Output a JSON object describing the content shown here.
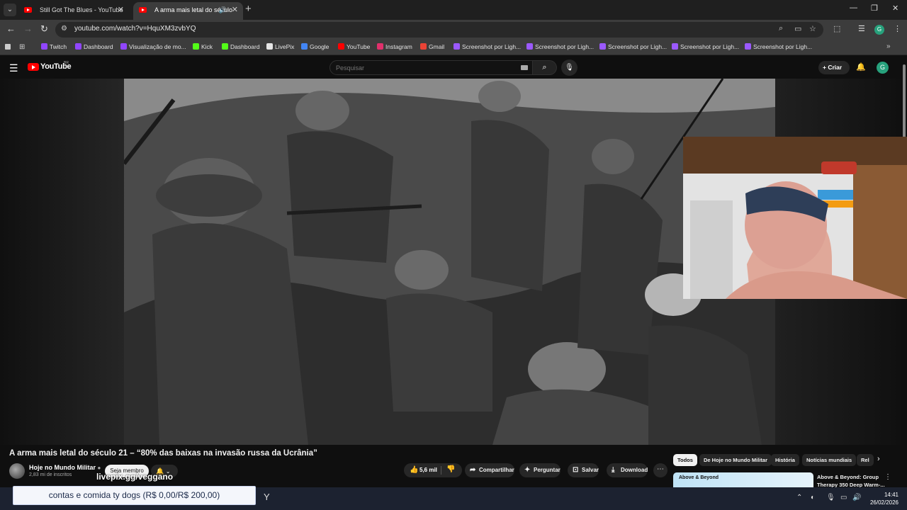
{
  "browser": {
    "tabs": [
      {
        "title": "Still Got The Blues - YouTube",
        "active": false
      },
      {
        "title": "A arma mais letal do século",
        "active": true
      }
    ],
    "url": "youtube.com/watch?v=HquXM3zvbYQ",
    "bookmarks": [
      {
        "label": "Twitch",
        "color": "#9146ff"
      },
      {
        "label": "Dashboard",
        "color": "#9146ff"
      },
      {
        "label": "Visualização de mo...",
        "color": "#9146ff"
      },
      {
        "label": "Kick",
        "color": "#53fc18"
      },
      {
        "label": "Dashboard",
        "color": "#53fc18"
      },
      {
        "label": "LivePix",
        "color": "#e6e6e6"
      },
      {
        "label": "Google",
        "color": "#4285f4"
      },
      {
        "label": "YouTube",
        "color": "#ff0000"
      },
      {
        "label": "Instagram",
        "color": "#e1306c"
      },
      {
        "label": "Gmail",
        "color": "#ea4335"
      },
      {
        "label": "Screenshot por Ligh...",
        "color": "#9b59ff"
      },
      {
        "label": "Screenshot por Ligh...",
        "color": "#9b59ff"
      },
      {
        "label": "Screenshot por Ligh...",
        "color": "#9b59ff"
      },
      {
        "label": "Screenshot por Ligh...",
        "color": "#9b59ff"
      },
      {
        "label": "Screenshot por Ligh...",
        "color": "#9b59ff"
      }
    ],
    "profile_initial": "G"
  },
  "youtube": {
    "logo_text": "YouTube",
    "region": "BR",
    "search_placeholder": "Pesquisar",
    "create_label": "Criar",
    "avatar_initial": "G"
  },
  "video": {
    "title": "A arma mais letal do século 21 – “80% das baixas na invasão russa da Ucrânia”",
    "channel": "Hoje no Mundo Militar",
    "subscribers": "2,83 mi de inscritos",
    "member_label": "Seja membro",
    "likes": "5,6 mil",
    "actions": {
      "share": "Compartilhar",
      "ask": "Perguntar",
      "save": "Salvar",
      "download": "Download"
    }
  },
  "filter_chips": [
    "Todos",
    "De Hoje no Mundo Militar",
    "História",
    "Notícias mundiais",
    "Rel"
  ],
  "recommendation": {
    "thumb_brand": "Above & Beyond",
    "title": "Above & Beyond: Group Therapy 350 Deep Warm-..."
  },
  "overlay": {
    "livepix": "livepix.gg/veggano",
    "donation": "contas e comida ty dogs (R$ 0,00/R$ 200,00)"
  },
  "taskbar": {
    "time": "14:41",
    "date": "26/02/2026"
  }
}
